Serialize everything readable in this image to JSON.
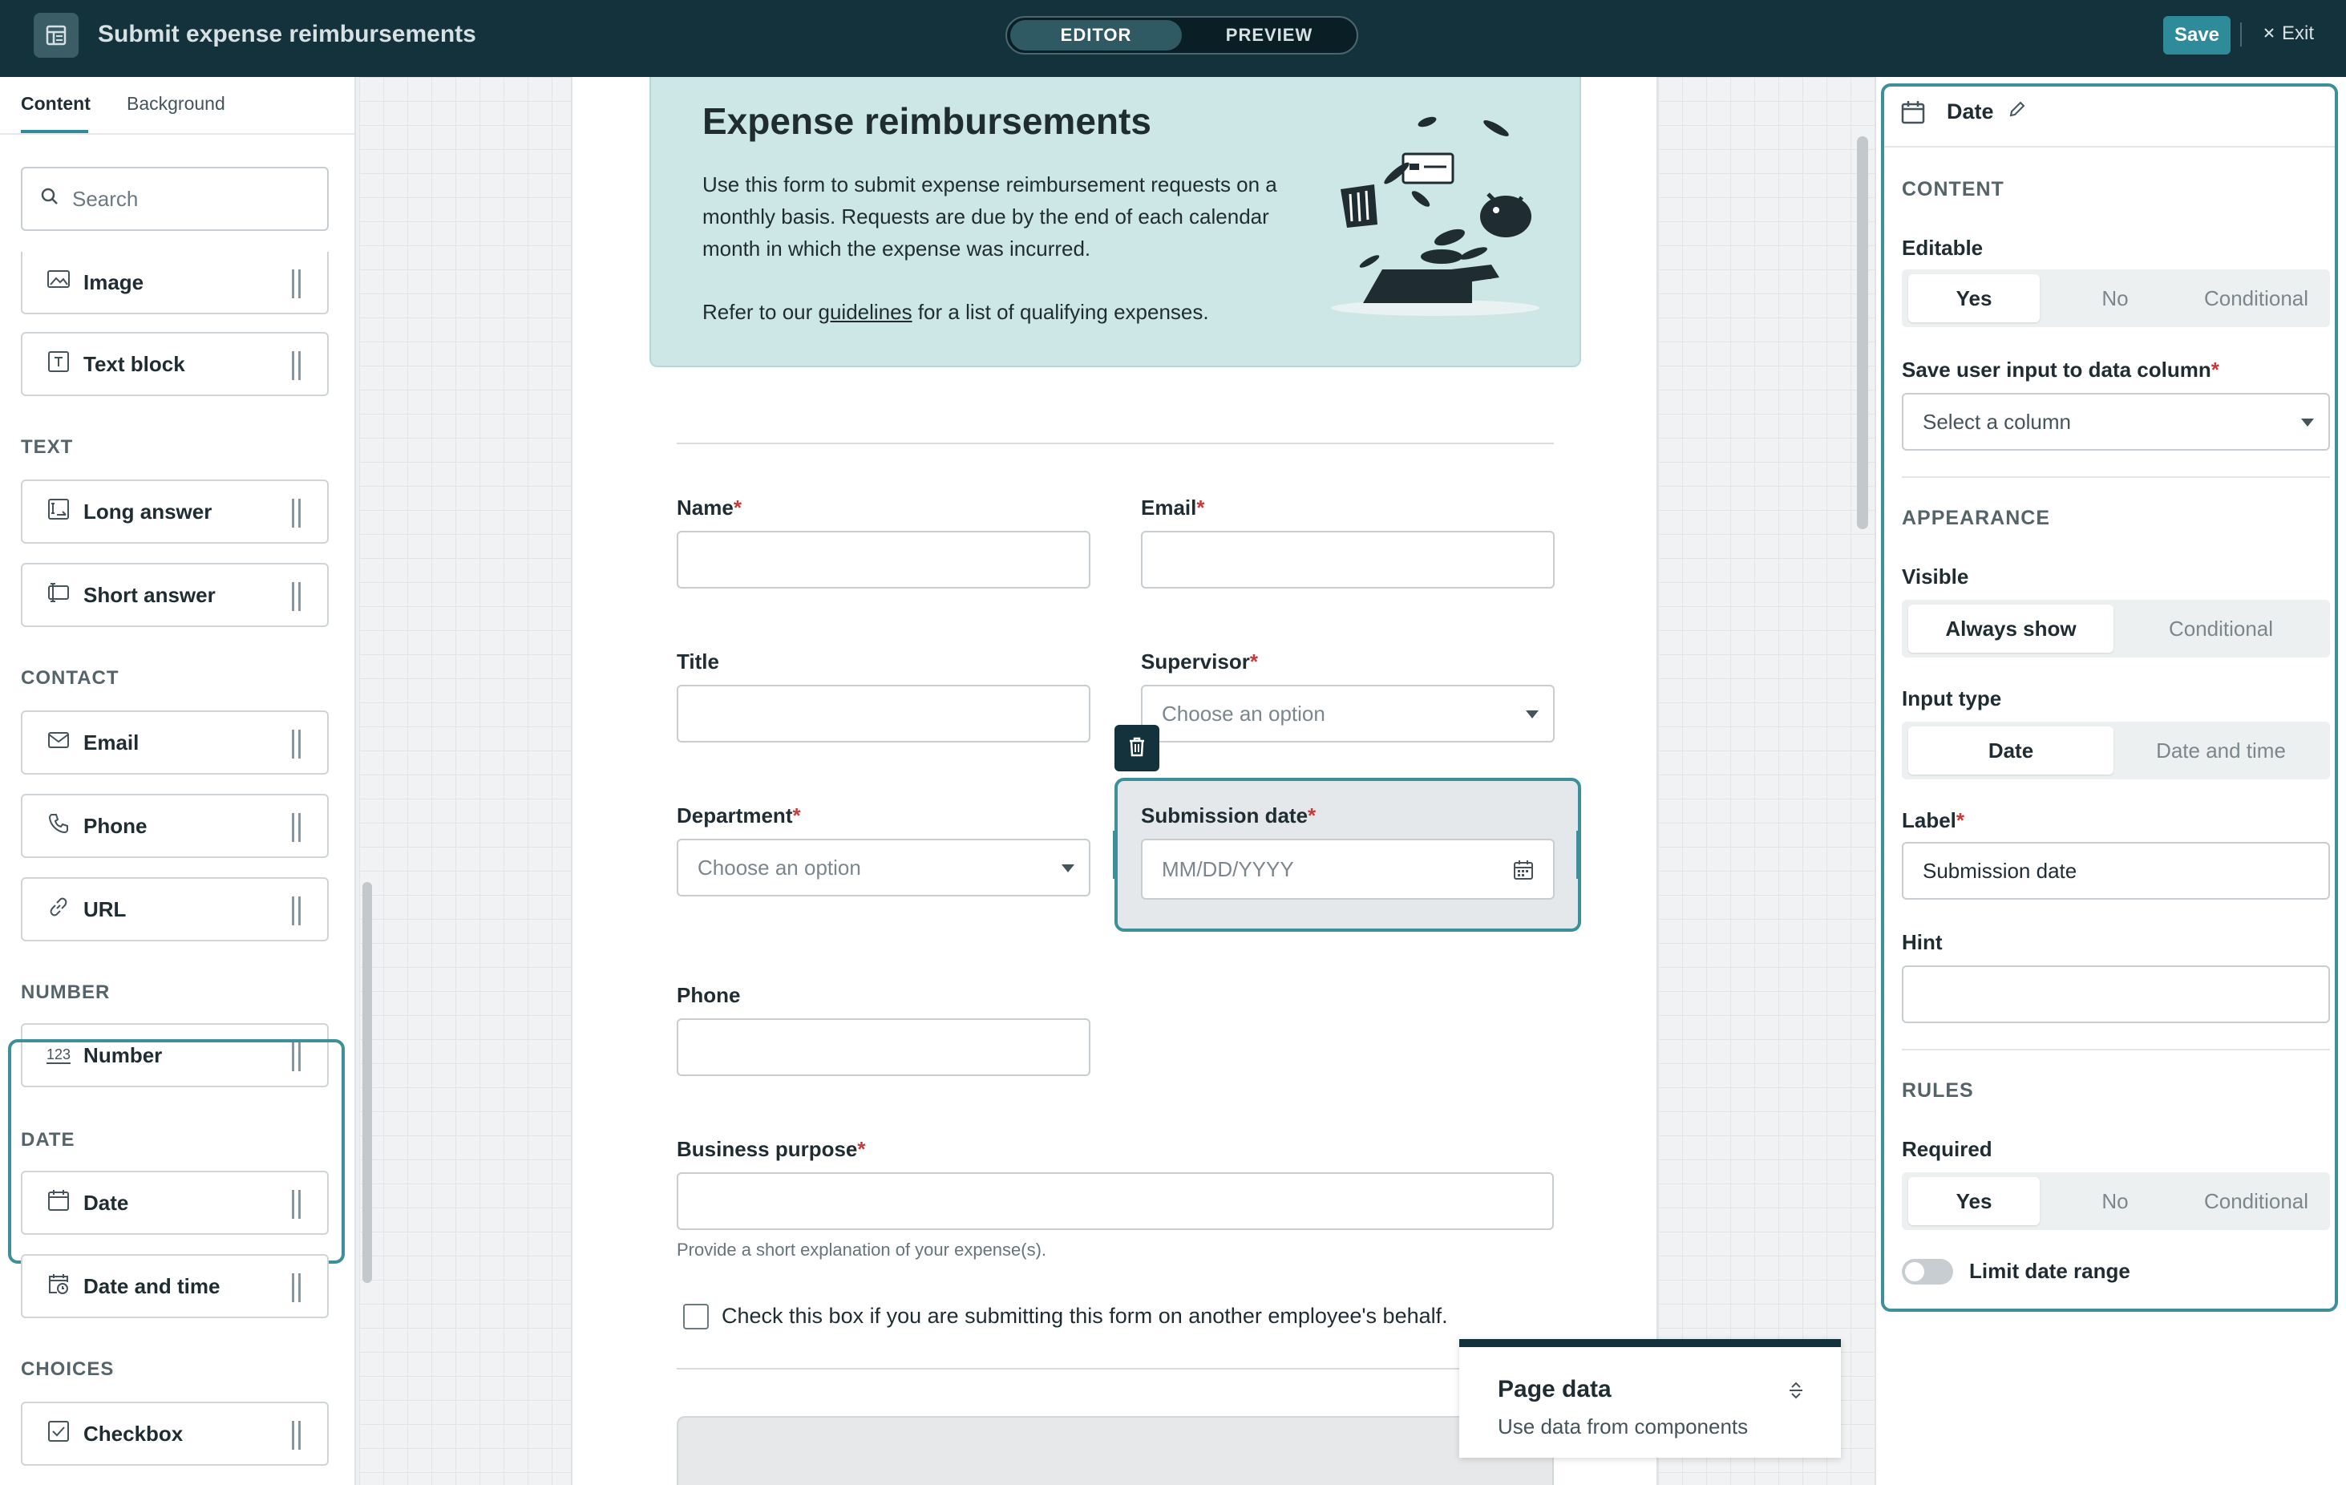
{
  "topbar": {
    "title": "Submit expense reimbursements",
    "mode_editor": "EDITOR",
    "mode_preview": "PREVIEW",
    "save_label": "Save",
    "exit_label": "Exit"
  },
  "sidebar": {
    "tabs": [
      "Content",
      "Background"
    ],
    "search_placeholder": "Search",
    "sections": {
      "text": "TEXT",
      "contact": "CONTACT",
      "number": "NUMBER",
      "date": "DATE",
      "choices": "CHOICES"
    },
    "components": {
      "image": "Image",
      "text_block": "Text block",
      "long_answer": "Long answer",
      "short_answer": "Short answer",
      "email": "Email",
      "phone": "Phone",
      "url": "URL",
      "number": "Number",
      "date": "Date",
      "date_time": "Date and time",
      "checkbox": "Checkbox"
    }
  },
  "form": {
    "banner_title": "Expense reimbursements",
    "banner_text": "Use this form to submit expense reimbursement requests on a monthly basis. Requests are due by the end of each calendar month in which the expense was incurred.",
    "banner_text2_before": "Refer to our ",
    "banner_link": "guidelines",
    "banner_text2_after": " for a list of qualifying expenses.",
    "fields": {
      "name": "Name",
      "email": "Email",
      "title": "Title",
      "supervisor": "Supervisor",
      "supervisor_placeholder": "Choose an option",
      "department": "Department",
      "department_placeholder": "Choose an option",
      "submission_date": "Submission date",
      "date_placeholder": "MM/DD/YYYY",
      "phone": "Phone",
      "business_purpose": "Business purpose",
      "business_hint": "Provide a short explanation of your expense(s).",
      "checkbox_label": "Check this box if you are submitting this form on another employee's behalf."
    },
    "required_mark": "*"
  },
  "page_data": {
    "title": "Page data",
    "subtitle": "Use data from components"
  },
  "inspector": {
    "title": "Date",
    "content_section": "CONTENT",
    "editable_label": "Editable",
    "editable_options": [
      "Yes",
      "No",
      "Conditional"
    ],
    "save_column_label": "Save user input to data column",
    "column_placeholder": "Select a column",
    "appearance_section": "APPEARANCE",
    "visible_label": "Visible",
    "visible_options": [
      "Always show",
      "Conditional"
    ],
    "input_type_label": "Input type",
    "input_type_options": [
      "Date",
      "Date and time"
    ],
    "label_label": "Label",
    "label_value": "Submission date",
    "hint_label": "Hint",
    "hint_value": "",
    "rules_section": "RULES",
    "required_label": "Required",
    "required_options": [
      "Yes",
      "No",
      "Conditional"
    ],
    "limit_range_label": "Limit date range"
  },
  "colors": {
    "topbar": "#13323b",
    "accent": "#3d8f99",
    "save": "#2e8b99",
    "banner": "#cde6e6",
    "required": "#c53a3a"
  }
}
